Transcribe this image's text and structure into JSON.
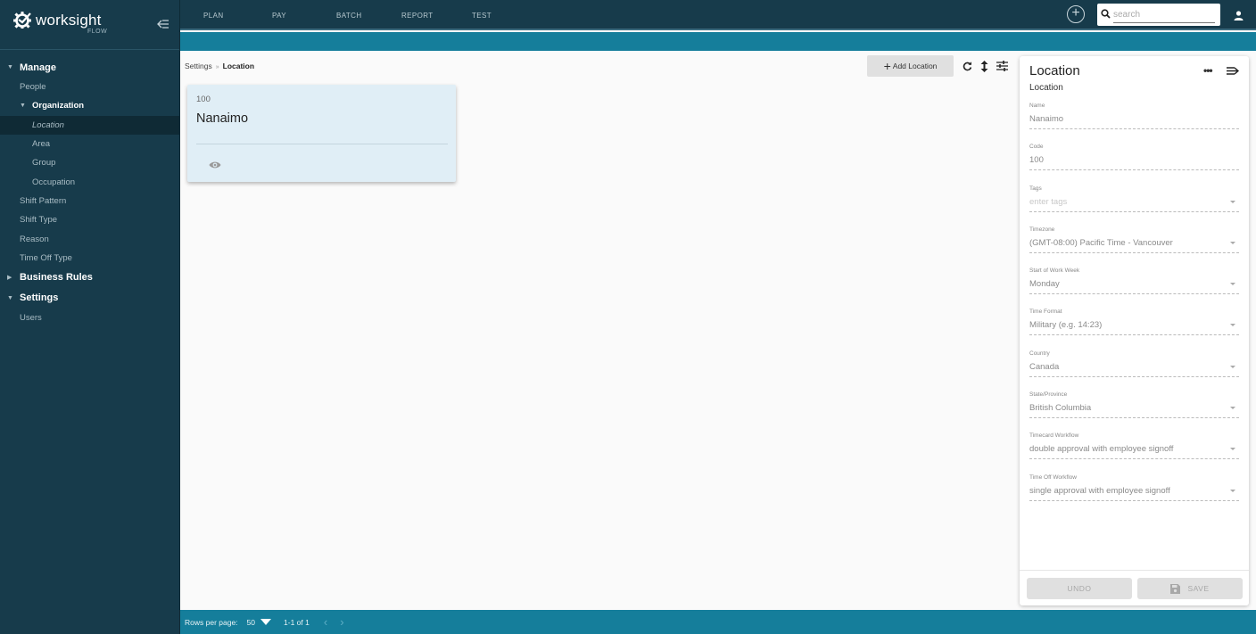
{
  "app": {
    "brand": "worksight",
    "brand_sub": "FLOW"
  },
  "topnav": {
    "tabs": [
      {
        "label": "PLAN"
      },
      {
        "label": "PAY"
      },
      {
        "label": "BATCH"
      },
      {
        "label": "REPORT"
      },
      {
        "label": "TEST"
      }
    ],
    "search_placeholder": "search",
    "search_value": ""
  },
  "sidebar": {
    "sections": [
      {
        "label": "Manage",
        "expanded": true
      },
      {
        "label": "Business Rules",
        "expanded": false
      },
      {
        "label": "Settings",
        "expanded": true
      }
    ],
    "manage_items": {
      "people": "People",
      "organization": "Organization",
      "location": "Location",
      "area": "Area",
      "group": "Group",
      "occupation": "Occupation",
      "shift_pattern": "Shift Pattern",
      "shift_type": "Shift Type",
      "reason": "Reason",
      "time_off_type": "Time Off Type"
    },
    "settings_items": {
      "users": "Users"
    },
    "active_item": "Location"
  },
  "breadcrumb": {
    "parent": "Settings",
    "separator": "»",
    "current": "Location"
  },
  "toolbar": {
    "add_label": "Add Location"
  },
  "cards": [
    {
      "code": "100",
      "name": "Nanaimo"
    }
  ],
  "panel": {
    "title": "Location",
    "subtitle": "Location",
    "fields": [
      {
        "label": "Name",
        "value": "Nanaimo",
        "placeholder": false,
        "dropdown": false
      },
      {
        "label": "Code",
        "value": "100",
        "placeholder": false,
        "dropdown": false
      },
      {
        "label": "Tags",
        "value": "enter tags",
        "placeholder": true,
        "dropdown": true
      },
      {
        "label": "Timezone",
        "value": "(GMT-08:00) Pacific Time - Vancouver",
        "placeholder": false,
        "dropdown": true
      },
      {
        "label": "Start of Work Week",
        "value": "Monday",
        "placeholder": false,
        "dropdown": true
      },
      {
        "label": "Time Format",
        "value": "Military (e.g. 14:23)",
        "placeholder": false,
        "dropdown": true
      },
      {
        "label": "Country",
        "value": "Canada",
        "placeholder": false,
        "dropdown": true
      },
      {
        "label": "State/Province",
        "value": "British Columbia",
        "placeholder": false,
        "dropdown": true
      },
      {
        "label": "Timecard Workflow",
        "value": "double approval with employee signoff",
        "placeholder": false,
        "dropdown": true
      },
      {
        "label": "Time Off Workflow",
        "value": "single approval with employee signoff",
        "placeholder": false,
        "dropdown": true
      }
    ],
    "undo_label": "UNDO",
    "save_label": "SAVE"
  },
  "pagination": {
    "rows_per_page_label": "Rows per page:",
    "rows_per_page": "50",
    "range": "1-1 of 1"
  },
  "colors": {
    "sidebar_bg": "#173b4b",
    "accent": "#157e9b",
    "card_bg": "#e0eef6"
  }
}
